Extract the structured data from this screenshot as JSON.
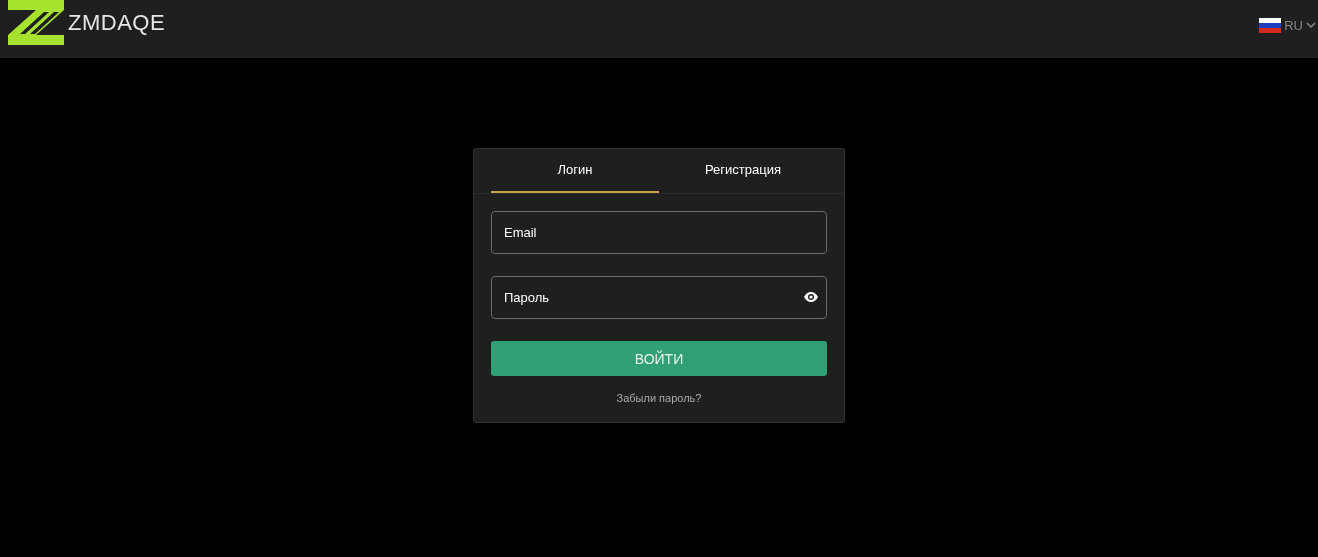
{
  "header": {
    "brand": "ZMDAQE",
    "language": "RU"
  },
  "tabs": [
    {
      "label": "Логин",
      "selected": true
    },
    {
      "label": "Регистрация",
      "selected": false
    }
  ],
  "fields": [
    {
      "placeholder": "Email",
      "kind": "text"
    },
    {
      "placeholder": "Пароль",
      "kind": "password"
    }
  ],
  "submit": "ВОЙТИ",
  "forgot_link": "Забыли пароль?"
}
